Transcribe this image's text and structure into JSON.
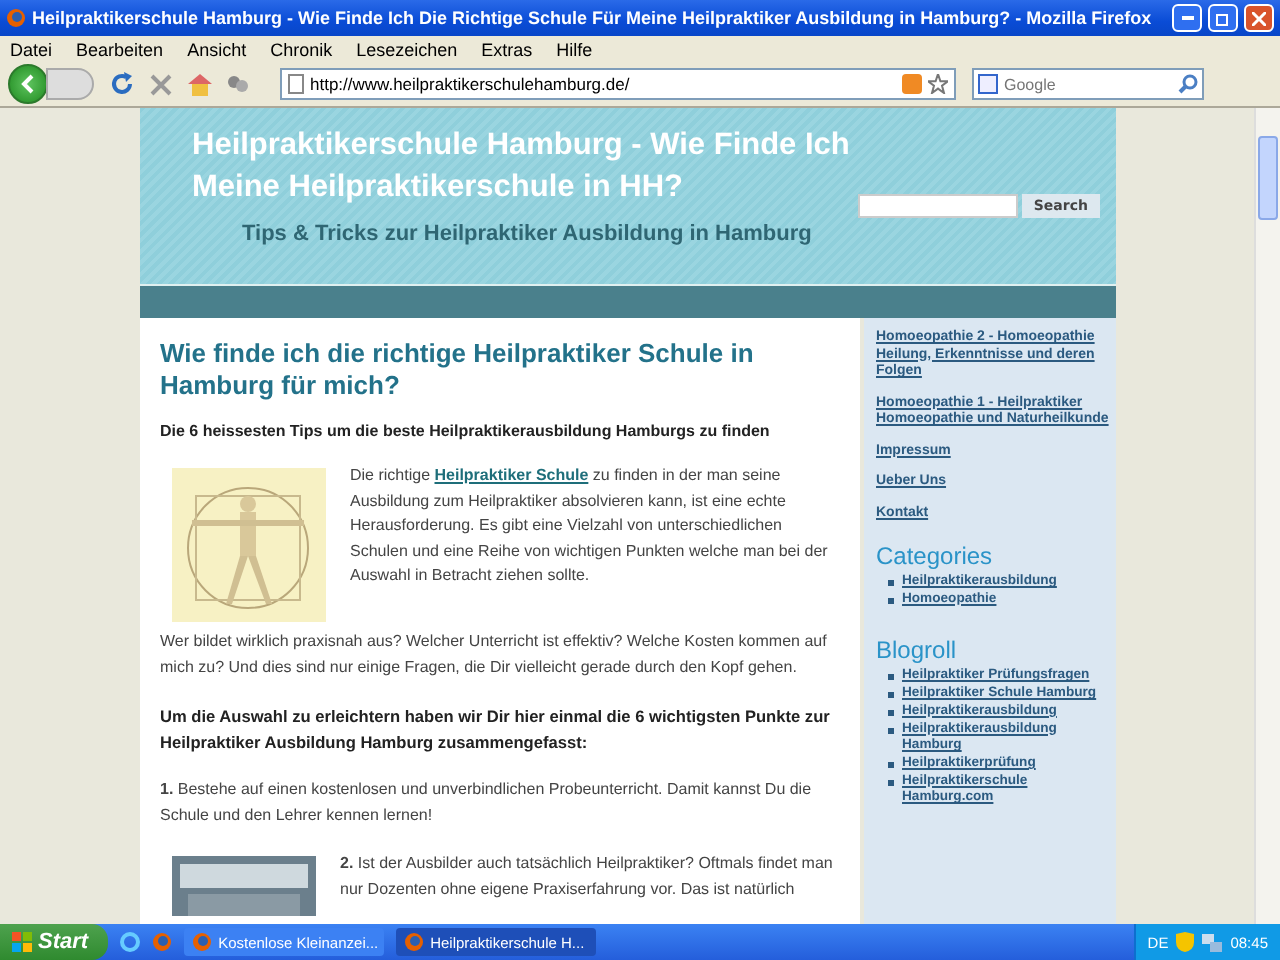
{
  "window": {
    "title": "Heilpraktikerschule Hamburg - Wie Finde Ich Die Richtige Schule Für Meine Heilpraktiker Ausbildung in Hamburg? - Mozilla Firefox"
  },
  "menu": [
    "Datei",
    "Bearbeiten",
    "Ansicht",
    "Chronik",
    "Lesezeichen",
    "Extras",
    "Hilfe"
  ],
  "toolbar": {
    "url": "http://www.heilpraktikerschulehamburg.de/",
    "search_placeholder": "Google"
  },
  "header": {
    "title": "Heilpraktikerschule Hamburg - Wie Finde Ich Meine Heilpraktikerschule in HH?",
    "subtitle": "Tips & Tricks zur Heilpraktiker Ausbildung in Hamburg",
    "search_button": "Search"
  },
  "article": {
    "heading": "Wie finde ich die richtige Heilpraktiker Schule in Hamburg für mich?",
    "lead": "Die 6 heissesten Tips um die beste Heilpraktikerausbildung Hamburgs zu finden",
    "intro": {
      "before": "Die richtige ",
      "link": "Heilpraktiker Schule",
      "after": " zu finden in der man seine Ausbildung zum Heilpraktiker absolvieren kann,  ist eine echte Herausforderung. Es gibt eine Vielzahl von unterschiedlichen Schulen und eine Reihe von wichtigen Punkten welche man bei der Auswahl in Betracht ziehen sollte."
    },
    "questions": "Wer bildet wirklich praxisnah aus? Welcher Unterricht ist effektiv? Welche Kosten kommen auf mich zu? Und dies sind nur einige Fragen, die Dir vielleicht gerade durch den Kopf gehen.",
    "summary": "Um die Auswahl zu erleichtern haben wir Dir hier einmal die 6 wichtigsten Punkte zur Heilpraktiker Ausbildung Hamburg zusammengefasst:",
    "point1": "**1.** Bestehe auf einen kostenlosen und unverbindlichen Probeunterricht. Damit kannst Du die Schule und den Lehrer kennen lernen!",
    "point2": "**2.** Ist der Ausbilder auch tatsächlich Heilpraktiker? Oftmals findet man nur Dozenten ohne eigene Praxiserfahrung vor. Das ist natürlich"
  },
  "sidebar": {
    "pages": [
      "Homoeopathie 2 - Homoeopathie Heilung, Erkenntnisse und deren Folgen",
      "Homoeopathie 1 - Heilpraktiker Homoeopathie und Naturheilkunde",
      "Impressum",
      "Ueber Uns",
      "Kontakt"
    ],
    "categories": {
      "title": "Categories",
      "items": [
        "Heilpraktikerausbildung",
        "Homoeopathie"
      ]
    },
    "blogroll": {
      "title": "Blogroll",
      "items": [
        "Heilpraktiker Prüfungsfragen",
        "Heilpraktiker Schule Hamburg",
        "Heilpraktikerausbildung",
        "Heilpraktikerausbildung Hamburg",
        "Heilpraktikerprüfung",
        "Heilpraktikerschule Hamburg.com"
      ]
    }
  },
  "taskbar": {
    "start": "Start",
    "tasks": [
      {
        "label": "Kostenlose Kleinanzei...",
        "selected": false
      },
      {
        "label": "Heilpraktikerschule H...",
        "selected": true
      }
    ],
    "language": "DE",
    "clock": "08:45"
  }
}
